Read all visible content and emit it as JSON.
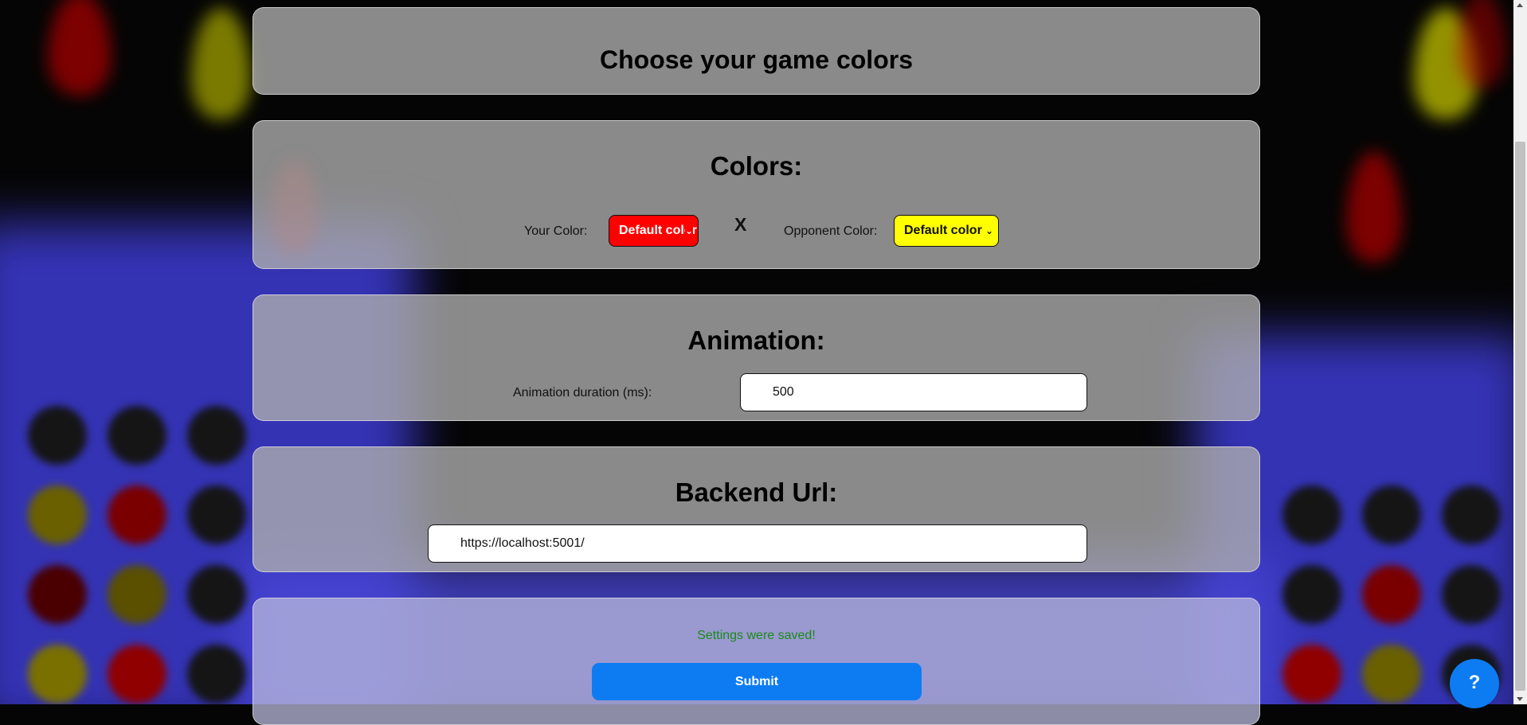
{
  "page": {
    "title": "Choose your game colors"
  },
  "colors_section": {
    "heading": "Colors:",
    "your_color_label": "Your Color:",
    "your_color_value": "Default color",
    "your_color_bg": "#ff0000",
    "separator": "X",
    "opponent_color_label": "Opponent Color:",
    "opponent_color_value": "Default color",
    "opponent_color_bg": "#ffff00"
  },
  "animation_section": {
    "heading": "Animation:",
    "duration_label": "Animation duration (ms):",
    "duration_value": "500"
  },
  "backend_section": {
    "heading": "Backend Url:",
    "url_value": "https://localhost:5001/"
  },
  "submit_section": {
    "status_message": "Settings were saved!",
    "submit_label": "Submit"
  },
  "help": {
    "label": "?"
  },
  "theme": {
    "accent": "#0d7cf2",
    "success": "#1a8a1a"
  }
}
